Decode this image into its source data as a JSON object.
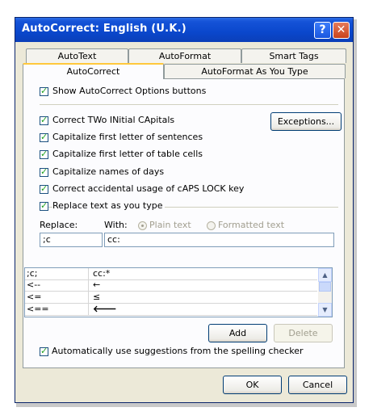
{
  "window": {
    "title": "AutoCorrect: English (U.K.)",
    "help_glyph": "?",
    "close_glyph": "✕"
  },
  "tabs": {
    "row_back": [
      "AutoText",
      "AutoFormat",
      "Smart Tags"
    ],
    "row_front": [
      "AutoCorrect",
      "AutoFormat As You Type"
    ],
    "active": "AutoCorrect"
  },
  "options": {
    "show_buttons": "Show AutoCorrect Options buttons",
    "two_initial": "Correct TWo INitial CApitals",
    "cap_sentences": "Capitalize first letter of sentences",
    "cap_cells": "Capitalize first letter of table cells",
    "cap_days": "Capitalize names of days",
    "caps_lock": "Correct accidental usage of cAPS LOCK key",
    "replace_text": "Replace text as you type",
    "auto_suggest": "Automatically use suggestions from the spelling checker"
  },
  "buttons": {
    "exceptions": "Exceptions...",
    "add": "Add",
    "delete": "Delete",
    "ok": "OK",
    "cancel": "Cancel"
  },
  "replace": {
    "replace_label": "Replace:",
    "with_label": "With:",
    "plain_text": "Plain text",
    "formatted_text": "Formatted text",
    "replace_value": ";c",
    "with_value": "cc:"
  },
  "entries": [
    {
      "replace": ";c;",
      "with": "cc:*"
    },
    {
      "replace": "<--",
      "with": "←"
    },
    {
      "replace": "<=",
      "with": "≤"
    },
    {
      "replace": "<==",
      "with": "🡐"
    }
  ],
  "colors": {
    "title_bar": "#0a47cc",
    "dialog_bg": "#ece9d8",
    "active_tab_accent": "#ffc83c"
  }
}
